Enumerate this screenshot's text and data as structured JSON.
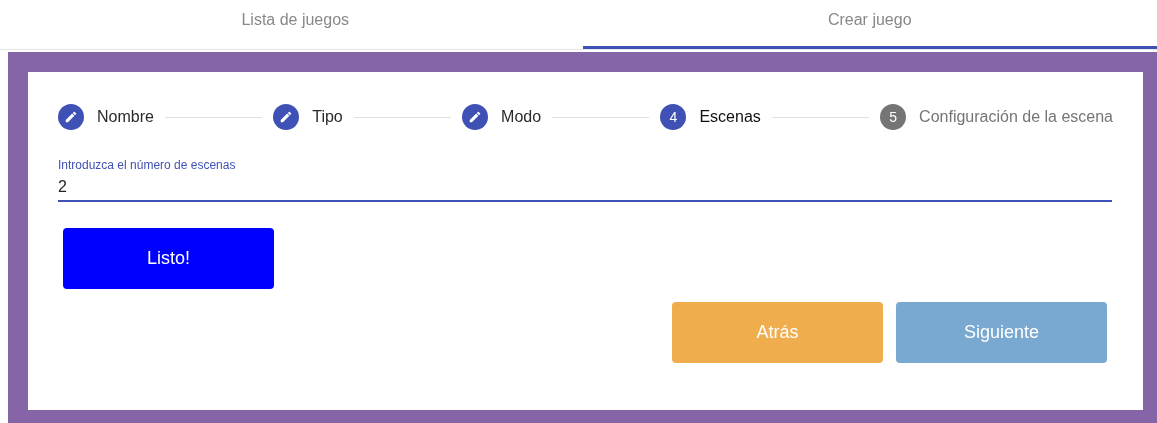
{
  "tabs": [
    {
      "label": "Lista de juegos",
      "selected": false
    },
    {
      "label": "Crear juego",
      "selected": true
    }
  ],
  "stepper": [
    {
      "label": "Nombre",
      "completed": true,
      "active": false
    },
    {
      "label": "Tipo",
      "completed": true,
      "active": false
    },
    {
      "label": "Modo",
      "completed": true,
      "active": false
    },
    {
      "label": "Escenas",
      "completed": false,
      "active": true,
      "number": "4"
    },
    {
      "label": "Configuración de la escena",
      "completed": false,
      "active": false,
      "number": "5"
    }
  ],
  "field": {
    "label": "Introduzca el número de escenas",
    "value": "2",
    "focused": true
  },
  "confirm_button": {
    "label": "Listo!",
    "disabled": false
  },
  "nav_buttons": [
    {
      "label": "Atrás",
      "kind": "back",
      "disabled": false
    },
    {
      "label": "Siguiente",
      "kind": "next",
      "disabled": true
    }
  ]
}
